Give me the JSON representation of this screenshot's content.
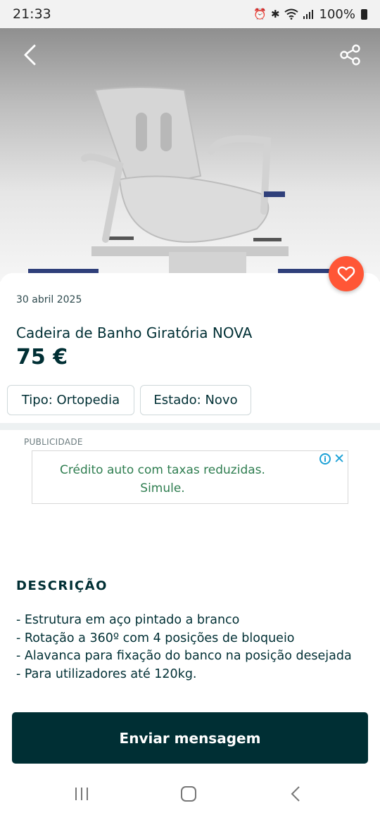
{
  "status_bar": {
    "time": "21:33",
    "battery_text": "100%",
    "icons": [
      "alarm-icon",
      "bluetooth-icon",
      "wifi-icon",
      "signal-icon",
      "battery-icon"
    ]
  },
  "header": {
    "back_icon": "chevron-left-icon",
    "share_icon": "share-icon"
  },
  "listing": {
    "date": "30 abril 2025",
    "title": "Cadeira de Banho Giratória NOVA",
    "price": "75 €",
    "favorite_icon": "heart-icon",
    "tags": [
      {
        "label": "Tipo: Ortopedia"
      },
      {
        "label": "Estado: Novo"
      }
    ]
  },
  "ad": {
    "label": "PUBLICIDADE",
    "text": "Crédito auto com taxas reduzidas. Simule.",
    "info_glyph": "i",
    "close_glyph": "✕"
  },
  "description": {
    "heading": "DESCRIÇÃO",
    "lines": [
      "- Estrutura em aço pintado a branco",
      "- Rotação a 360º com 4 posições de bloqueio",
      "- Alavanca para fixação do banco na posição desejada",
      "- Para utilizadores até 120kg."
    ]
  },
  "actions": {
    "send_message": "Enviar mensagem"
  },
  "colors": {
    "primary_dark": "#002f34",
    "favorite": "#ff5636",
    "ad_text": "#2e7d4f",
    "ad_icon": "#1aa0d6"
  }
}
